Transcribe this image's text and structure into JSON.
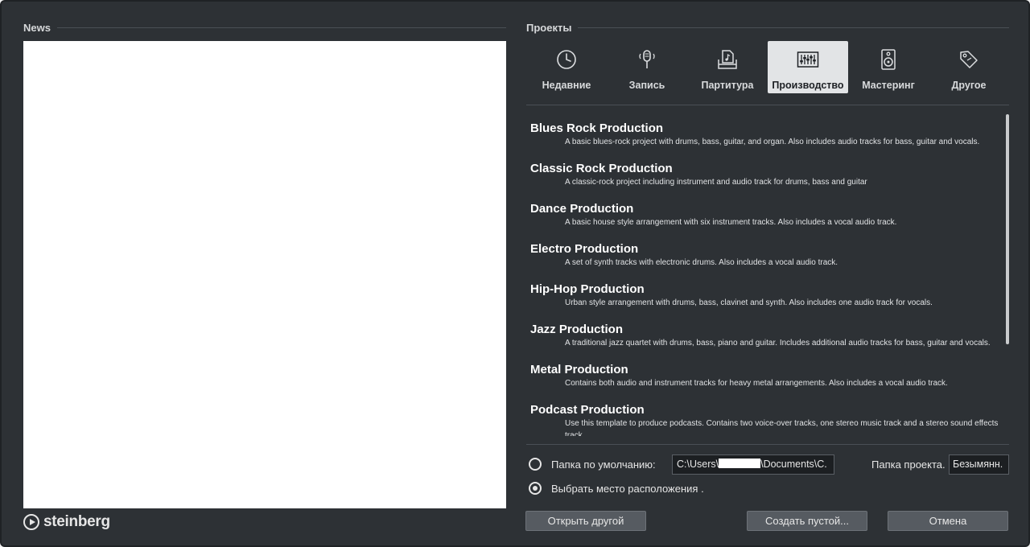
{
  "news": {
    "title": "News"
  },
  "logo": {
    "text": "steinberg"
  },
  "projects": {
    "title": "Проекты",
    "tabs": [
      {
        "label": "Недавние",
        "icon": "clock-icon",
        "active": false
      },
      {
        "label": "Запись",
        "icon": "microphone-icon",
        "active": false
      },
      {
        "label": "Партитура",
        "icon": "score-icon",
        "active": false
      },
      {
        "label": "Производство",
        "icon": "mixer-faders-icon",
        "active": true
      },
      {
        "label": "Мастеринг",
        "icon": "speaker-icon",
        "active": false
      },
      {
        "label": "Другое",
        "icon": "tag-icon",
        "active": false
      }
    ],
    "templates": [
      {
        "title": "Blues Rock Production",
        "desc": "A basic blues-rock project with drums, bass, guitar, and organ. Also includes audio tracks for bass, guitar and vocals."
      },
      {
        "title": "Classic Rock Production",
        "desc": "A classic-rock project including instrument and audio track for drums, bass and guitar"
      },
      {
        "title": "Dance Production",
        "desc": "A basic house style arrangement with six instrument tracks. Also includes a vocal audio track."
      },
      {
        "title": "Electro Production",
        "desc": "A set of synth tracks with electronic drums. Also includes a vocal audio track."
      },
      {
        "title": "Hip-Hop Production",
        "desc": "Urban style arrangement with drums, bass, clavinet and synth. Also includes one audio track for vocals."
      },
      {
        "title": "Jazz Production",
        "desc": "A traditional jazz quartet with drums, bass, piano and guitar. Includes additional audio tracks for bass, guitar and vocals."
      },
      {
        "title": "Metal Production",
        "desc": "Contains both audio and instrument tracks for heavy metal arrangements. Also includes a vocal audio track."
      },
      {
        "title": "Podcast Production",
        "desc": "Use this template to produce podcasts. Contains two voice-over tracks, one stereo music track and a stereo sound effects track."
      }
    ]
  },
  "location": {
    "default_label": "Папка по умолчанию:",
    "path_prefix": "C:\\Users\\",
    "path_suffix": "\\Documents\\C.",
    "project_folder_label": "Папка проекта.",
    "project_folder_value": "Безымянн.",
    "choose_label": "Выбрать место расположения ."
  },
  "buttons": {
    "open_other": "Открыть другой",
    "create_empty": "Создать пустой...",
    "cancel": "Отмена"
  },
  "colors": {
    "background": "#2d3135",
    "active_tab": "#e2e4e6",
    "button": "#565b61"
  }
}
